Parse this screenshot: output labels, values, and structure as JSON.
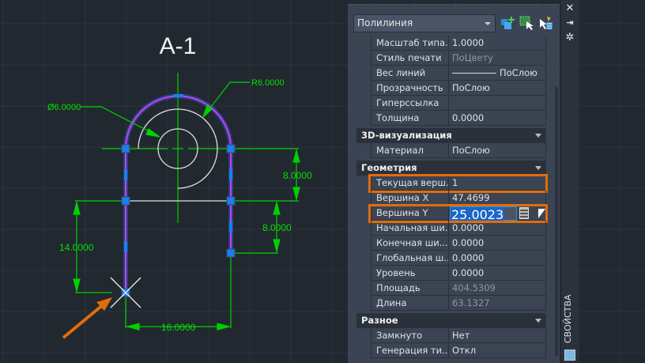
{
  "drawing": {
    "title": "A-1",
    "dims": {
      "diameter": "Ø6.0000",
      "radius": "R6.0000",
      "upper_right": "8.0000",
      "lower_right": "8.0000",
      "left": "14.0000",
      "bottom": "16.0000"
    },
    "colors": {
      "polyline": "#c040ff",
      "dimension": "#00e000",
      "geometry": "#e0e0e0",
      "grip": "#1a7ef0",
      "callout": "#e36c0a"
    }
  },
  "panel": {
    "object_type": "Полилиния",
    "toolbar": [
      {
        "icon": "add-to-selection-icon"
      },
      {
        "icon": "quick-select-icon"
      },
      {
        "icon": "toggle-pickadd-icon"
      }
    ],
    "rows": [
      {
        "label": "Масштаб типа...",
        "value": "1.0000"
      },
      {
        "label": "Стиль печати",
        "value": "ПоЦвету",
        "dim": true
      },
      {
        "label": "Вес линий",
        "value": "ПоСлою",
        "line": true
      },
      {
        "label": "Прозрачность",
        "value": "ПоСлою"
      },
      {
        "label": "Гиперссылка",
        "value": ""
      },
      {
        "label": "Толщина",
        "value": "0.0000"
      },
      {
        "section": "3D-визуализация"
      },
      {
        "label": "Материал",
        "value": "ПоСлою"
      },
      {
        "section": "Геометрия"
      },
      {
        "label": "Текущая верш...",
        "value": "1",
        "highlight": true
      },
      {
        "label": "Вершина X",
        "value": "47.4699"
      },
      {
        "label": "Вершина Y",
        "value": "25.0023",
        "highlight": true,
        "editing": true
      },
      {
        "label": "Начальная ши...",
        "value": "0.0000"
      },
      {
        "label": "Конечная ши...",
        "value": "0.0000"
      },
      {
        "label": "Глобальная ш...",
        "value": "0.0000"
      },
      {
        "label": "Уровень",
        "value": "0.0000"
      },
      {
        "label": "Площадь",
        "value": "404.5309",
        "dim": true
      },
      {
        "label": "Длина",
        "value": "63.1327",
        "dim": true
      },
      {
        "section": "Разное"
      },
      {
        "label": "Замкнуто",
        "value": "Нет"
      },
      {
        "label": "Генерация ти...",
        "value": "Откл"
      }
    ],
    "side_tab": "СВОЙСТВА"
  }
}
